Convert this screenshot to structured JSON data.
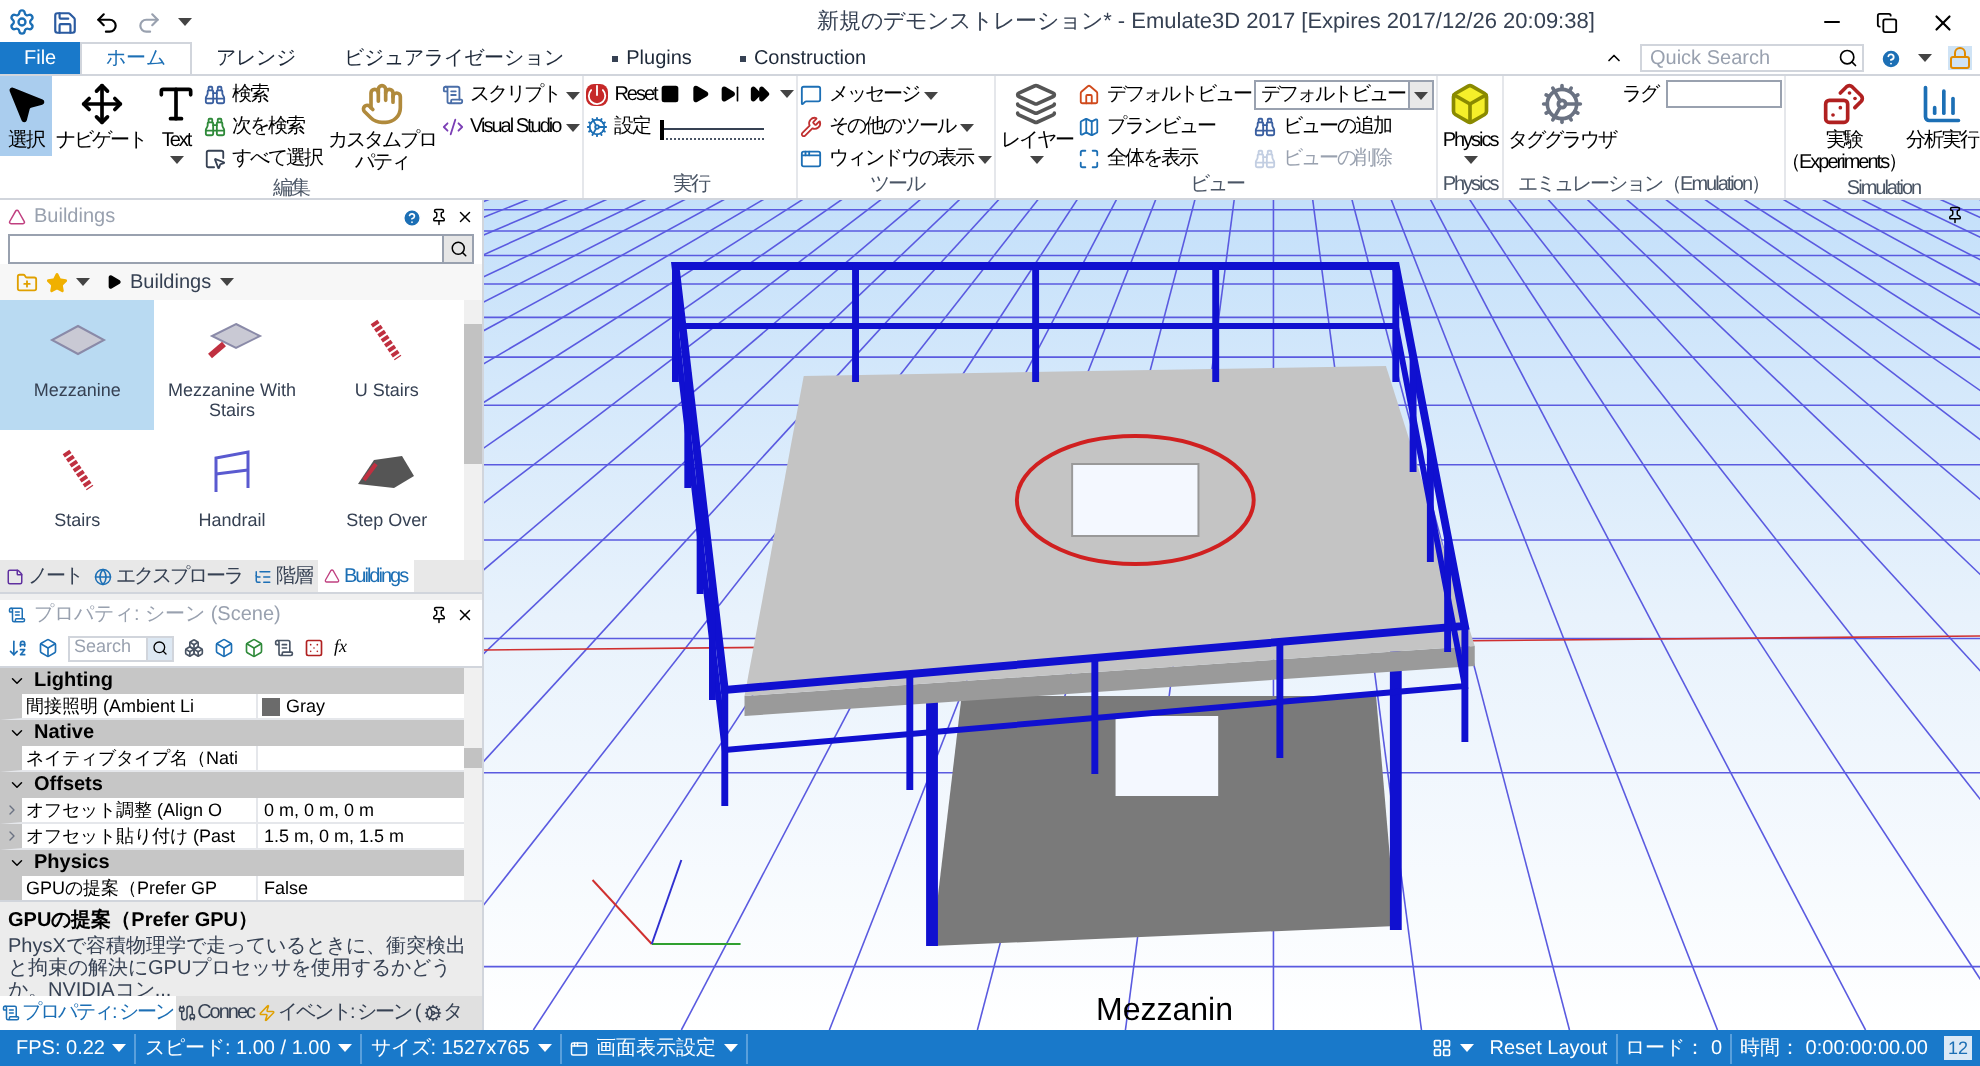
{
  "window": {
    "title": "新規のデモンストレーション* - Emulate3D 2017 [Expires 2017/12/26 20:09:38]"
  },
  "quick_search": {
    "placeholder": "Quick Search"
  },
  "ribbon_tabs": [
    {
      "label": "File",
      "kind": "file",
      "selected": false
    },
    {
      "label": "ホーム",
      "kind": "tab",
      "selected": true
    },
    {
      "label": "アレンジ",
      "kind": "tab",
      "selected": false
    },
    {
      "label": "ビジュアライゼーション",
      "kind": "tab",
      "selected": false
    },
    {
      "label": "Plugins",
      "kind": "bullet",
      "selected": false
    },
    {
      "label": "Construction",
      "kind": "bullet",
      "selected": false
    }
  ],
  "ribbon_groups": [
    {
      "title": "編集",
      "columns": [
        {
          "kind": "large",
          "label": "選択",
          "selected": true,
          "dropdown": false
        },
        {
          "kind": "large",
          "label": "ナビゲート",
          "selected": false,
          "dropdown": false
        },
        {
          "kind": "large",
          "label": "Text",
          "selected": false,
          "dropdown": true
        },
        {
          "kind": "stack",
          "items": [
            {
              "kind": "button",
              "label": "検索",
              "dropdown": false,
              "disabled": false
            },
            {
              "kind": "button",
              "label": "次を検索",
              "dropdown": false,
              "disabled": false
            },
            {
              "kind": "button",
              "label": "すべて選択",
              "dropdown": false,
              "disabled": false
            }
          ]
        },
        {
          "kind": "large",
          "label": "カスタムプロパティ",
          "selected": false,
          "dropdown": false
        },
        {
          "kind": "stack",
          "items": [
            {
              "kind": "button",
              "label": "スクリプト",
              "dropdown": true,
              "disabled": false
            },
            {
              "kind": "button",
              "label": "Visual Studio",
              "dropdown": true,
              "disabled": false
            }
          ]
        }
      ]
    },
    {
      "title": "実行",
      "columns": [
        {
          "kind": "stack",
          "items": [
            {
              "kind": "button",
              "label": "Reset",
              "dropdown": false,
              "disabled": false
            },
            {
              "kind": "button",
              "label": "設定",
              "dropdown": false,
              "disabled": false
            }
          ]
        },
        {
          "kind": "transport",
          "level": 0.0,
          "dropdown": true
        }
      ]
    },
    {
      "title": "ツール",
      "columns": [
        {
          "kind": "stack",
          "items": [
            {
              "kind": "button",
              "label": "メッセージ",
              "dropdown": true,
              "disabled": false
            },
            {
              "kind": "button",
              "label": "その他のツール",
              "dropdown": true,
              "disabled": false
            },
            {
              "kind": "button",
              "label": "ウィンドウの表示",
              "dropdown": true,
              "disabled": false
            }
          ]
        }
      ]
    },
    {
      "title": "ビュー",
      "columns": [
        {
          "kind": "large",
          "label": "レイヤー",
          "selected": false,
          "dropdown": true
        },
        {
          "kind": "stack",
          "items": [
            {
              "kind": "button",
              "label": "デフォルトビュー",
              "dropdown": false,
              "disabled": false
            },
            {
              "kind": "button",
              "label": "プランビュー",
              "dropdown": false,
              "disabled": false
            },
            {
              "kind": "button",
              "label": "全体を表示",
              "dropdown": false,
              "disabled": false
            }
          ]
        },
        {
          "kind": "stack",
          "items": [
            {
              "kind": "combo",
              "label": "デフォルトビュー",
              "dropdown": true
            },
            {
              "kind": "button",
              "label": "ビューの追加",
              "dropdown": false,
              "disabled": false
            },
            {
              "kind": "button",
              "label": "ビューの削除",
              "dropdown": false,
              "disabled": true
            }
          ]
        }
      ]
    },
    {
      "title": "Physics",
      "columns": [
        {
          "kind": "large",
          "label": "Physics",
          "selected": false,
          "dropdown": true
        }
      ]
    },
    {
      "title": "エミュレーション（Emulation）",
      "columns": [
        {
          "kind": "large",
          "label": "タググラウザ",
          "selected": false,
          "dropdown": false
        },
        {
          "kind": "field",
          "label": "ラグ"
        }
      ]
    },
    {
      "title": "Simulation",
      "columns": [
        {
          "kind": "large",
          "label": "実験（Experiments）",
          "selected": false,
          "dropdown": false
        },
        {
          "kind": "large",
          "label": "分析実行",
          "selected": false,
          "dropdown": false
        }
      ]
    }
  ],
  "catalog": {
    "title": "Buildings",
    "breadcrumb": "Buildings",
    "items": [
      {
        "label": "Mezzanine",
        "selected": true
      },
      {
        "label": "Mezzanine With Stairs",
        "selected": false
      },
      {
        "label": "U Stairs",
        "selected": false
      },
      {
        "label": "Stairs",
        "selected": false
      },
      {
        "label": "Handrail",
        "selected": false
      },
      {
        "label": "Step Over",
        "selected": false
      }
    ],
    "tabs": [
      {
        "label": "ノート",
        "selected": false
      },
      {
        "label": "エクスプローラ",
        "selected": false
      },
      {
        "label": "階層",
        "selected": false
      },
      {
        "label": "Buildings",
        "selected": true
      }
    ]
  },
  "properties": {
    "title": "プロパティ: シーン (Scene)",
    "search": {
      "placeholder": "Search"
    },
    "function_button": "fx",
    "categories": [
      {
        "name": "Lighting",
        "expanded": true,
        "rows": [
          {
            "name": "間接照明 (Ambient Li",
            "value": "Gray",
            "expandable": false,
            "color": "#6b6b6b"
          }
        ]
      },
      {
        "name": "Native",
        "expanded": true,
        "rows": [
          {
            "name": "ネイティブタイプ名（Nati",
            "expandable": false
          }
        ]
      },
      {
        "name": "Offsets",
        "expanded": true,
        "rows": [
          {
            "name": "オフセット調整 (Align O",
            "value": "0 m, 0 m, 0 m",
            "expandable": true
          },
          {
            "name": "オフセット貼り付け (Past",
            "value": "1.5 m, 0 m, 1.5 m",
            "expandable": true
          }
        ]
      },
      {
        "name": "Physics",
        "expanded": true,
        "rows": [
          {
            "name": "GPUの提案（Prefer GP",
            "value": "False",
            "expandable": false
          }
        ]
      }
    ],
    "description": {
      "title": "GPUの提案（Prefer GPU）",
      "text": "PhysXで容積物理学で走っているときに、衝突検出と拘束の解決にGPUプロセッサを使用するかどうか。NVIDIAコン..."
    },
    "tabs": [
      {
        "label": "プロパティ: シーン",
        "selected": true
      },
      {
        "label": "Connec",
        "selected": false
      },
      {
        "label": "イベント: シーン (",
        "selected": false
      },
      {
        "label": "タ",
        "selected": false
      }
    ]
  },
  "viewport": {
    "label": "Mezzanin"
  },
  "status_bar": {
    "left": [
      {
        "label": "FPS: 0.22"
      },
      {
        "label": "スピード: 1.00 / 1.00"
      },
      {
        "label": "サイズ: 1527x765"
      },
      {
        "label": "画面表示設定"
      }
    ],
    "reset_layout": "Reset Layout",
    "load": "ロード： 0",
    "time": "時間： 0:00:00:00.00",
    "badge": "12"
  }
}
